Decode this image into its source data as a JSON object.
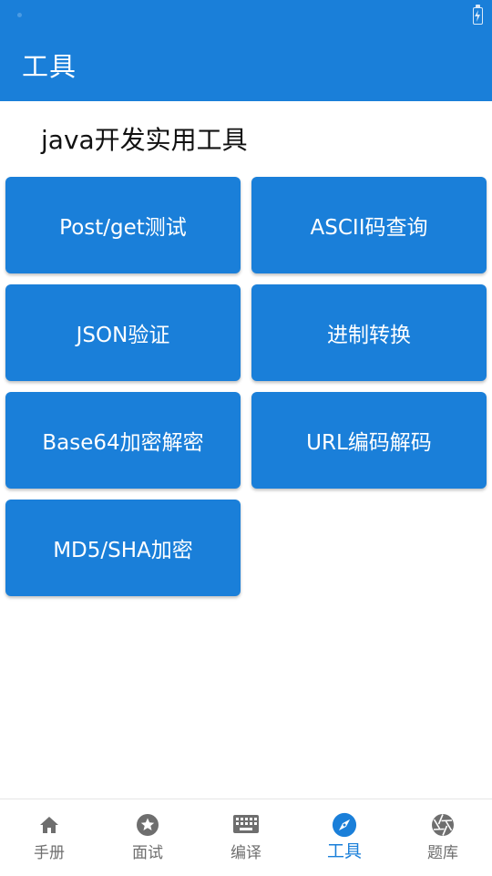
{
  "app_bar": {
    "title": "工具"
  },
  "section_title": "java开发实用工具",
  "tools": [
    {
      "label": "Post/get测试"
    },
    {
      "label": "ASCII码查询"
    },
    {
      "label": "JSON验证"
    },
    {
      "label": "进制转换"
    },
    {
      "label": "Base64加密解密"
    },
    {
      "label": "URL编码解码"
    },
    {
      "label": "MD5/SHA加密"
    }
  ],
  "bottom_nav": {
    "active": "工具",
    "items": [
      {
        "label": "手册",
        "icon": "home-icon"
      },
      {
        "label": "面试",
        "icon": "star-icon"
      },
      {
        "label": "编译",
        "icon": "keyboard-icon"
      },
      {
        "label": "工具",
        "icon": "compass-icon"
      },
      {
        "label": "题库",
        "icon": "aperture-icon"
      }
    ]
  },
  "colors": {
    "primary": "#1a7fd9",
    "inactive": "#6e6e6e",
    "background": "#ffffff"
  }
}
